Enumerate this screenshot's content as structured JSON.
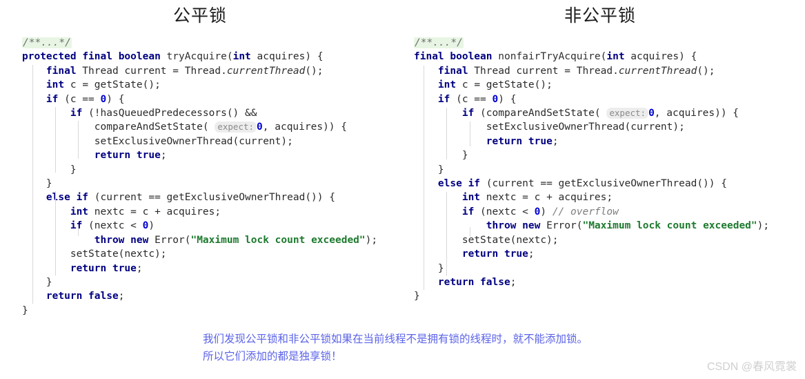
{
  "titles": {
    "fair": "公平锁",
    "unfair": "非公平锁"
  },
  "fair_code": {
    "fold_comment": "/**...*/",
    "lines": [
      "protected final boolean tryAcquire(int acquires) {",
      "    final Thread current = Thread.currentThread();",
      "    int c = getState();",
      "    if (c == 0) {",
      "        if (!hasQueuedPredecessors() &&",
      "            compareAndSetState( expect: 0, acquires)) {",
      "            setExclusiveOwnerThread(current);",
      "            return true;",
      "        }",
      "    }",
      "    else if (current == getExclusiveOwnerThread()) {",
      "        int nextc = c + acquires;",
      "        if (nextc < 0)",
      "            throw new Error(\"Maximum lock count exceeded\");",
      "        setState(nextc);",
      "        return true;",
      "    }",
      "    return false;",
      "}"
    ]
  },
  "unfair_code": {
    "fold_comment": "/**...*/",
    "lines": [
      "final boolean nonfairTryAcquire(int acquires) {",
      "    final Thread current = Thread.currentThread();",
      "    int c = getState();",
      "    if (c == 0) {",
      "        if (compareAndSetState( expect: 0, acquires)) {",
      "            setExclusiveOwnerThread(current);",
      "            return true;",
      "        }",
      "    }",
      "    else if (current == getExclusiveOwnerThread()) {",
      "        int nextc = c + acquires;",
      "        if (nextc < 0) // overflow",
      "            throw new Error(\"Maximum lock count exceeded\");",
      "        setState(nextc);",
      "        return true;",
      "    }",
      "    return false;",
      "}"
    ]
  },
  "tokens": {
    "kw_protected": "protected",
    "kw_final": "final",
    "kw_boolean": "boolean",
    "kw_int": "int",
    "kw_if": "if",
    "kw_else": "else",
    "kw_return": "return",
    "kw_true": "true",
    "kw_false": "false",
    "kw_throw": "throw",
    "kw_new": "new",
    "zero": "0",
    "hint_expect": "expect:",
    "string_error": "\"Maximum lock count exceeded\"",
    "comment_overflow": "// overflow",
    "method_fair": "tryAcquire",
    "method_unfair": "nonfairTryAcquire",
    "ident_currentThread": "currentThread"
  },
  "caption": {
    "line1": "我们发现公平锁和非公平锁如果在当前线程不是拥有锁的线程时，就不能添加锁。",
    "line2": "所以它们添加的都是独享锁！"
  },
  "watermark": {
    "text": "CSDN @春风霓裳"
  },
  "colors": {
    "keyword": "#000080",
    "string": "#1d7a2e",
    "number": "#0000d0",
    "comment": "#7d7d7d",
    "caption": "#5b63e8",
    "fold_background": "#e8f5e4",
    "hint_background": "#ededed",
    "watermark": "#cfcfcf",
    "page_background": "#ffffff"
  }
}
